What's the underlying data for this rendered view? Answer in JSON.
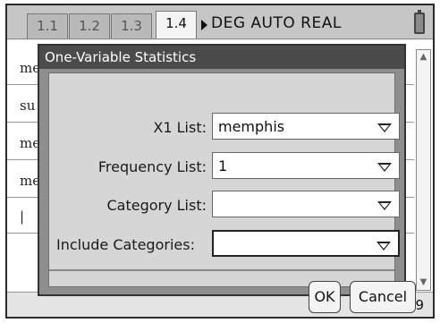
{
  "tabs": [
    {
      "label": "1.1",
      "active": false
    },
    {
      "label": "1.2",
      "active": false
    },
    {
      "label": "1.3",
      "active": false
    },
    {
      "label": "1.4",
      "active": true
    }
  ],
  "mode_status": "DEG AUTO REAL",
  "background_rows": [
    "me",
    "su",
    "me",
    "me",
    "|"
  ],
  "page_counter": "4/99",
  "dialog": {
    "title": "One-Variable Statistics",
    "fields": [
      {
        "label": "X1 List:",
        "value": "memphis"
      },
      {
        "label": "Frequency List:",
        "value": "1"
      },
      {
        "label": "Category List:",
        "value": ""
      },
      {
        "label": "Include Categories:",
        "value": ""
      }
    ],
    "ok_label": "OK",
    "cancel_label": "Cancel"
  },
  "icons": {
    "battery": "battery-icon",
    "mode_arrow": "play-triangle-icon",
    "dropdown": "chevron-down-icon"
  }
}
